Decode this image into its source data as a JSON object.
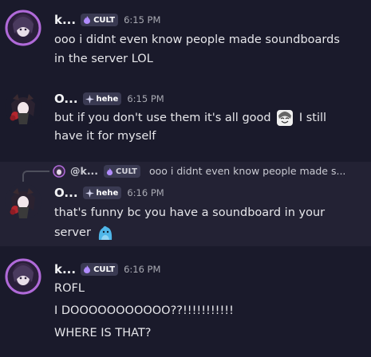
{
  "messages": [
    {
      "username": "k...",
      "tag": "CULT",
      "time": "6:15 PM",
      "lines": [
        "ooo i didnt even know people made soundboards",
        "in the server LOL"
      ]
    },
    {
      "username": "O...",
      "tag": "hehe",
      "time": "6:15 PM",
      "line1_before_emoji": "but if you don't use them it's all good",
      "line1_after_emoji": "I still",
      "line2": "have it for myself",
      "emoji": "smiling-face-emoji"
    },
    {
      "reply": {
        "username": "@k...",
        "tag": "CULT",
        "text": "ooo i didnt even know people made s..."
      },
      "username": "O...",
      "tag": "hehe",
      "time": "6:16 PM",
      "line1": "that's funny bc you have a soundboard in your",
      "line2": "server",
      "emoji": "blue-creature-emoji"
    },
    {
      "username": "k...",
      "tag": "CULT",
      "time": "6:16 PM",
      "lines": [
        "ROFL",
        "I DOOOOOOOOOOO??!!!!!!!!!!!",
        "WHERE IS THAT?"
      ]
    }
  ],
  "colors": {
    "background": "#1a1a2b",
    "highlight": "#232234",
    "tag_bg": "#3a3a52",
    "cult_icon": "#b18cff",
    "hehe_icon": "#d6d6f0"
  }
}
